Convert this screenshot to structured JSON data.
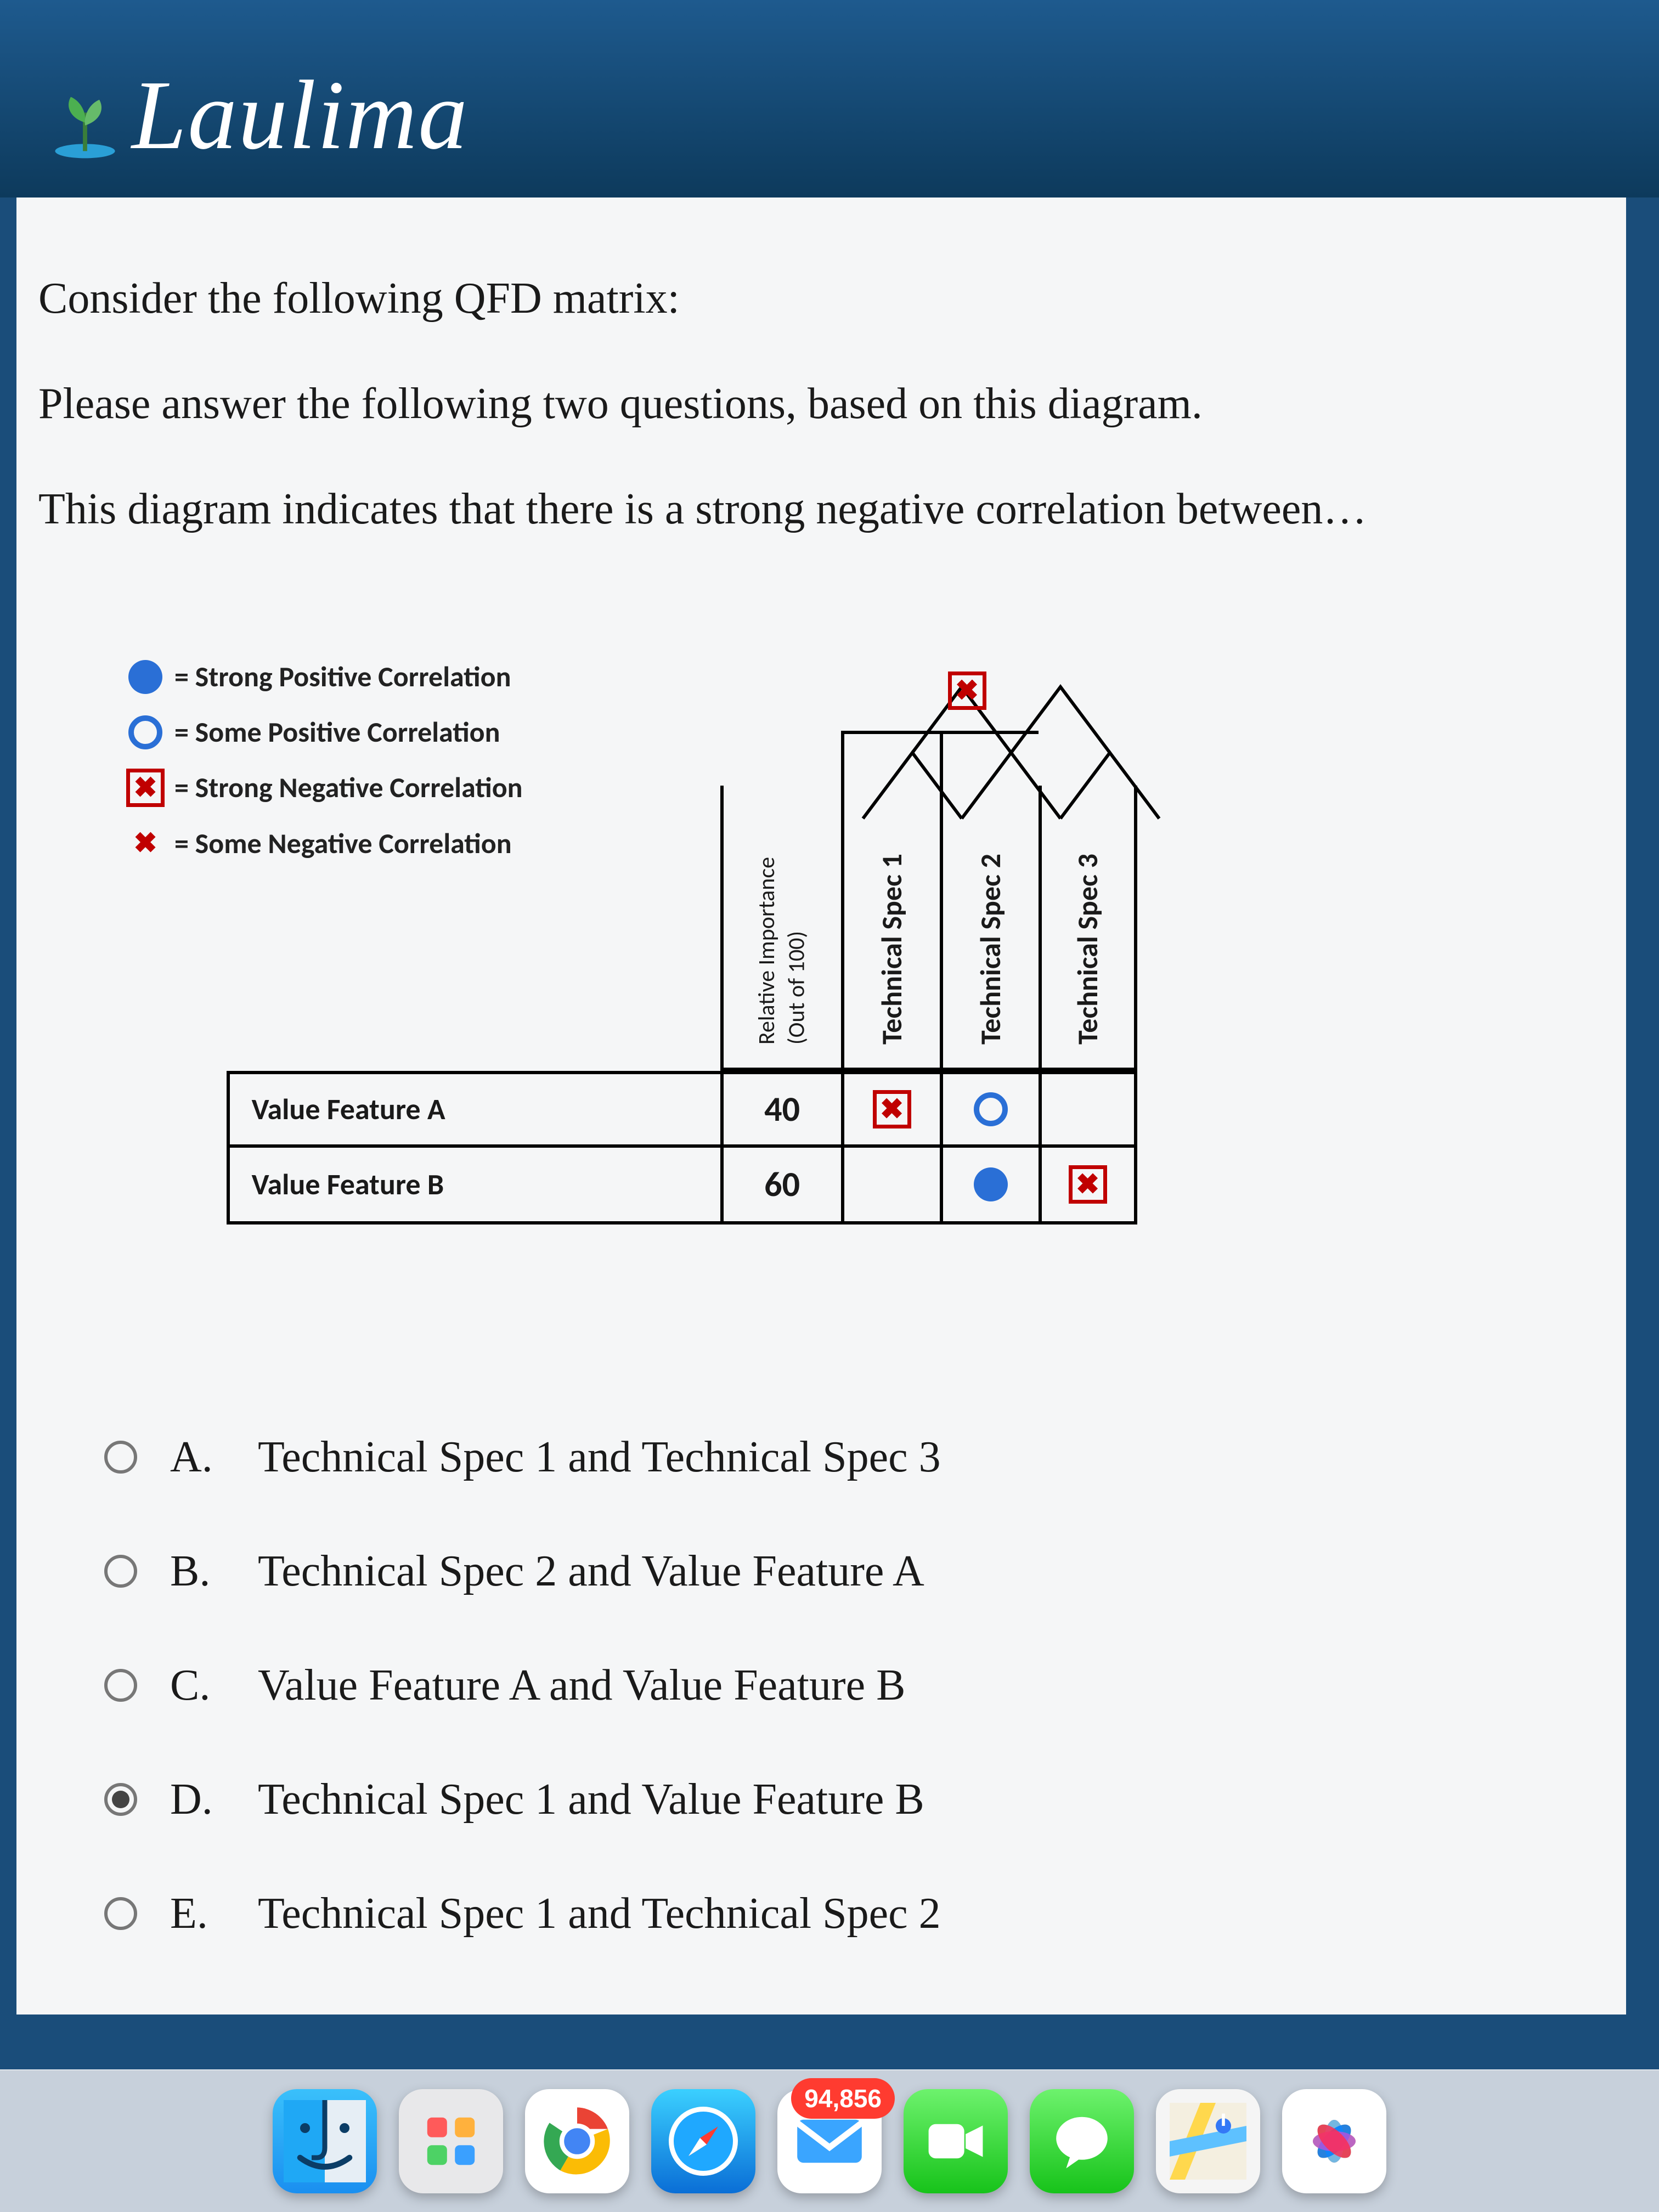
{
  "header": {
    "brand": "Laulima"
  },
  "question": {
    "intro": "Consider the following QFD matrix:",
    "instruction": "Please answer the following two questions, based on this diagram.",
    "prompt": "This diagram indicates that there is a strong negative correlation between…"
  },
  "legend": {
    "strong_positive": "= Strong Positive Correlation",
    "some_positive": "= Some Positive Correlation",
    "strong_negative": "= Strong Negative Correlation",
    "some_negative": "= Some Negative Correlation"
  },
  "qfd": {
    "importance_header_line1": "Relative Importance",
    "importance_header_line2": "(Out of 100)",
    "tech_specs": [
      "Technical Spec 1",
      "Technical Spec 2",
      "Technical Spec 3"
    ],
    "roof": [
      {
        "between": [
          "Technical Spec 1",
          "Technical Spec 2"
        ],
        "symbol": "strong_negative"
      }
    ],
    "rows": [
      {
        "label": "Value Feature A",
        "importance": "40",
        "cells": [
          "strong_negative",
          "some_positive",
          ""
        ]
      },
      {
        "label": "Value Feature B",
        "importance": "60",
        "cells": [
          "",
          "strong_positive",
          "strong_negative"
        ]
      }
    ]
  },
  "options": {
    "A": "Technical Spec 1 and Technical Spec 3",
    "B": "Technical Spec 2 and Value Feature A",
    "C": "Value Feature A and Value Feature B",
    "D": "Technical Spec 1 and Value Feature B",
    "E": "Technical Spec 1 and Technical Spec 2",
    "selected": "D"
  },
  "option_letters": {
    "A": "A.",
    "B": "B.",
    "C": "C.",
    "D": "D.",
    "E": "E."
  },
  "dock": {
    "mail_badge": "94,856"
  }
}
